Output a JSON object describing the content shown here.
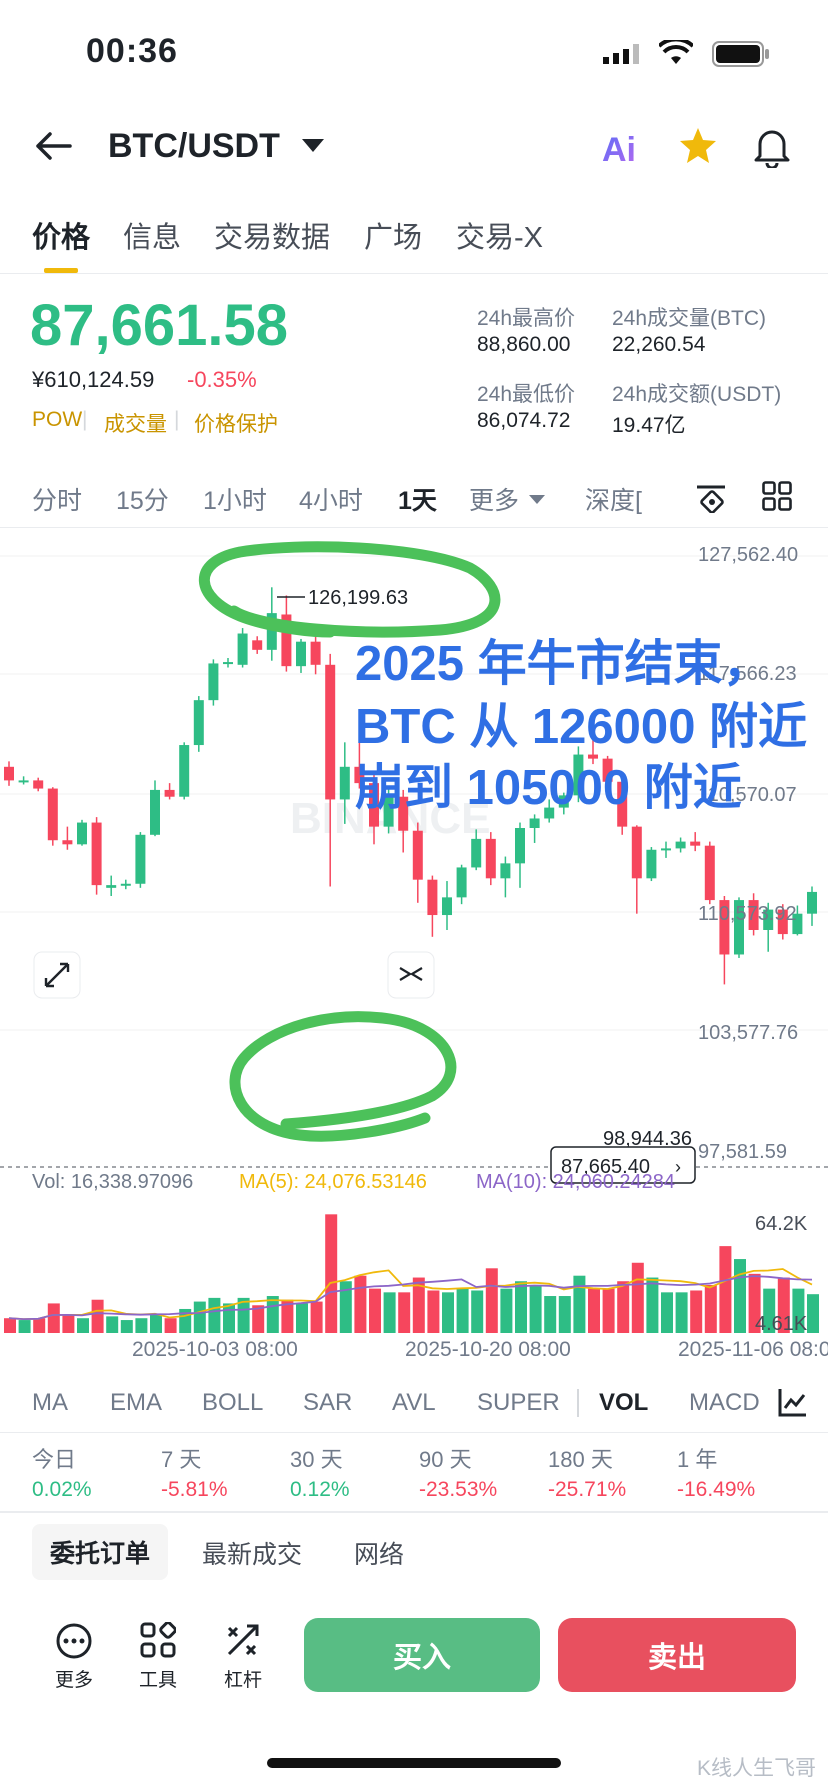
{
  "status_bar": {
    "time": "00:36"
  },
  "nav": {
    "title": "BTC/USDT",
    "ai_label": "Ai",
    "icons": [
      "back-arrow-icon",
      "dropdown-caret-icon",
      "star-icon",
      "bell-icon"
    ]
  },
  "tabs": [
    "价格",
    "信息",
    "交易数据",
    "广场",
    "交易-X"
  ],
  "ticker": {
    "last_price": "87,661.58",
    "cny_price": "¥610,124.59",
    "change_pct": "-0.35%",
    "tags": [
      "POW",
      "成交量",
      "价格保护"
    ],
    "stats": [
      {
        "label": "24h最高价",
        "value": "88,860.00"
      },
      {
        "label": "24h成交量(BTC)",
        "value": "22,260.54"
      },
      {
        "label": "24h最低价",
        "value": "86,074.72"
      },
      {
        "label": "24h成交额(USDT)",
        "value": "19.47亿"
      }
    ]
  },
  "intervals": {
    "items": [
      "分时",
      "15分",
      "1小时",
      "4小时",
      "1天",
      "更多",
      "深度["
    ],
    "active": "1天"
  },
  "chart": {
    "price_axis": [
      "127,562.40",
      "117,566.23",
      "110,570.07",
      "110,573.92",
      "103,577.76",
      "97,581.59"
    ],
    "high_label": "126,199.63",
    "low_label": "98,944.36",
    "current_tag": "87,665.40",
    "vol_line": {
      "vol": "Vol: 16,338.97096",
      "ma5": "MA(5): 24,076.53146",
      "ma10": "MA(10): 24,060.24284"
    },
    "vol_axis": [
      "64.2K",
      "4.61K"
    ],
    "date_labels": [
      "2025-10-03 08:00",
      "2025-10-20 08:00",
      "2025-11-06 08:00"
    ],
    "annotation": [
      "2025 年牛市结束，",
      "BTC 从 126000 附近",
      "崩到 105000 附近"
    ],
    "watermark": "BINANCE"
  },
  "chart_data": {
    "type": "candlestick",
    "ylim": [
      96000,
      128500
    ],
    "candles": [
      [
        113000,
        113400,
        111600,
        112000
      ],
      [
        111900,
        112300,
        111700,
        112000
      ],
      [
        112000,
        112200,
        111200,
        111400
      ],
      [
        111400,
        111500,
        107200,
        107600
      ],
      [
        107600,
        108600,
        106900,
        107300
      ],
      [
        107300,
        109100,
        107200,
        108900
      ],
      [
        108900,
        109300,
        103600,
        104300
      ],
      [
        104100,
        105000,
        103500,
        104300
      ],
      [
        104300,
        104700,
        104000,
        104400
      ],
      [
        104400,
        108200,
        104100,
        108000
      ],
      [
        108000,
        112000,
        107900,
        111300
      ],
      [
        111300,
        111800,
        110600,
        110800
      ],
      [
        110800,
        114800,
        110600,
        114600
      ],
      [
        114600,
        118200,
        114100,
        117900
      ],
      [
        117900,
        120900,
        117500,
        120600
      ],
      [
        120600,
        121000,
        120300,
        120700
      ],
      [
        120500,
        123200,
        120300,
        122800
      ],
      [
        122300,
        122600,
        121300,
        121600
      ],
      [
        121600,
        126199.63,
        120800,
        124300
      ],
      [
        124200,
        125600,
        120000,
        120400
      ],
      [
        120400,
        122400,
        119900,
        122200
      ],
      [
        122200,
        123000,
        119800,
        120500
      ],
      [
        120500,
        121300,
        104200,
        110600
      ],
      [
        110600,
        114800,
        108800,
        113000
      ],
      [
        113000,
        115800,
        111400,
        111800
      ],
      [
        111800,
        112600,
        107300,
        108600
      ],
      [
        108600,
        111500,
        108100,
        110800
      ],
      [
        110800,
        111300,
        106700,
        108300
      ],
      [
        108300,
        108900,
        103000,
        104700
      ],
      [
        104700,
        105000,
        100500,
        102100
      ],
      [
        102100,
        104600,
        101000,
        103400
      ],
      [
        103400,
        105800,
        102900,
        105600
      ],
      [
        105600,
        108400,
        105400,
        107700
      ],
      [
        107700,
        108200,
        104300,
        104800
      ],
      [
        104800,
        106400,
        103400,
        105900
      ],
      [
        105900,
        108900,
        104100,
        108500
      ],
      [
        108500,
        109500,
        107400,
        109200
      ],
      [
        109200,
        110600,
        108900,
        110000
      ],
      [
        110000,
        111100,
        109500,
        110900
      ],
      [
        110900,
        114500,
        110400,
        113900
      ],
      [
        113900,
        115300,
        113200,
        113600
      ],
      [
        113600,
        113800,
        111500,
        111900
      ],
      [
        111900,
        112300,
        108000,
        108600
      ],
      [
        108600,
        108700,
        102200,
        104800
      ],
      [
        104800,
        107100,
        104600,
        106900
      ],
      [
        106900,
        107500,
        106300,
        107000
      ],
      [
        107000,
        107800,
        106700,
        107500
      ],
      [
        107500,
        108200,
        106800,
        107200
      ],
      [
        107200,
        107500,
        102900,
        103200
      ],
      [
        103200,
        103500,
        97000,
        99200
      ],
      [
        99200,
        103400,
        98944.36,
        103200
      ],
      [
        103200,
        103700,
        100600,
        101000
      ],
      [
        101000,
        103000,
        99400,
        102500
      ],
      [
        102500,
        102900,
        100300,
        100700
      ],
      [
        100700,
        102800,
        100600,
        102200
      ],
      [
        102200,
        104200,
        101300,
        103800
      ]
    ],
    "volumes": [
      8,
      7,
      8,
      16,
      10,
      8,
      18,
      9,
      7,
      8,
      10,
      8,
      13,
      17,
      19,
      16,
      19,
      15,
      20,
      18,
      16,
      17,
      64.2,
      28,
      31,
      24,
      22,
      22,
      30,
      23,
      22,
      24,
      23,
      35,
      24,
      28,
      26,
      20,
      20,
      31,
      24,
      24,
      28,
      38,
      30,
      22,
      22,
      23,
      26,
      47,
      40,
      32,
      24,
      30,
      24,
      21
    ]
  },
  "indicators": {
    "items": [
      "MA",
      "EMA",
      "BOLL",
      "SAR",
      "AVL",
      "SUPER",
      "VOL",
      "MACD"
    ],
    "active": "VOL"
  },
  "performance": [
    {
      "label": "今日",
      "value": "0.02%"
    },
    {
      "label": "7 天",
      "value": "-5.81%"
    },
    {
      "label": "30 天",
      "value": "0.12%"
    },
    {
      "label": "90 天",
      "value": "-23.53%"
    },
    {
      "label": "180 天",
      "value": "-25.71%"
    },
    {
      "label": "1 年",
      "value": "-16.49%"
    }
  ],
  "bottom_tabs": [
    "委托订单",
    "最新成交",
    "网络"
  ],
  "actions": {
    "more": "更多",
    "tools": "工具",
    "leverage": "杠杆",
    "buy": "买入",
    "sell": "卖出"
  },
  "watermark": "K线人生飞哥",
  "colors": {
    "up": "#2ebd85",
    "down": "#f6465d",
    "accent": "#f0b90b",
    "annotation": "#2f6fe4",
    "circle": "#4cc15a",
    "ma5": "#f0b90b",
    "ma10": "#8c66c8"
  }
}
